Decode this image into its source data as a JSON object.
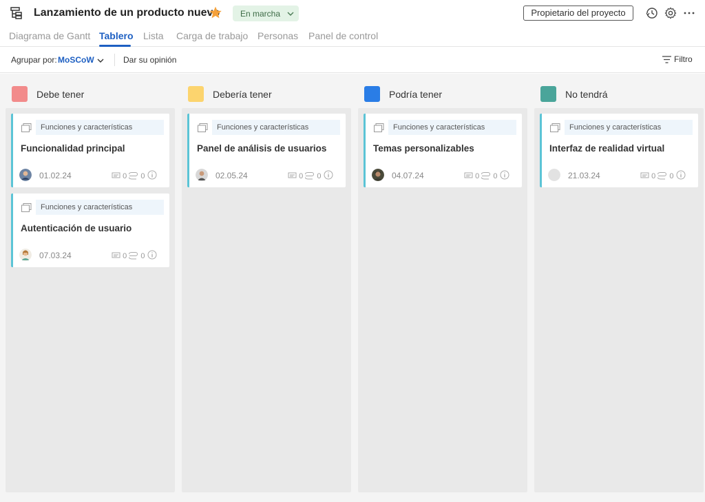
{
  "header": {
    "project_icon": "project-tree-icon",
    "title": "Lanzamiento de un producto nuevo",
    "favorite_icon": "star-icon",
    "status": "En marcha",
    "owner_button": "Propietario del proyecto",
    "icons": [
      "history-icon",
      "gear-icon",
      "more-icon"
    ]
  },
  "tabs": [
    {
      "label": "Diagrama de Gantt"
    },
    {
      "label": "Tablero"
    },
    {
      "label": "Lista"
    },
    {
      "label": "Carga de trabajo"
    },
    {
      "label": "Personas"
    },
    {
      "label": "Panel de control"
    }
  ],
  "toolbar": {
    "group_label": "Agrupar por:",
    "group_value": "MoSCoW",
    "feedback": "Dar su opinión",
    "filter": "Filtro"
  },
  "columns": [
    {
      "title": "Debe tener",
      "color": "#f28b8b"
    },
    {
      "title": "Debería tener",
      "color": "#fcd46e"
    },
    {
      "title": "Podría tener",
      "color": "#2a7de6"
    },
    {
      "title": "No tendrá",
      "color": "#4aa59a"
    }
  ],
  "cards": {
    "c0a": {
      "category": "Funciones y características",
      "title": "Funcionalidad principal",
      "date": "01.02.24",
      "comments": "0",
      "attachments": "0"
    },
    "c0b": {
      "category": "Funciones y características",
      "title": "Autenticación de usuario",
      "date": "07.03.24",
      "comments": "0",
      "attachments": "0"
    },
    "c1a": {
      "category": "Funciones y características",
      "title": "Panel de análisis de usuarios",
      "date": "02.05.24",
      "comments": "0",
      "attachments": "0"
    },
    "c2a": {
      "category": "Funciones y características",
      "title": "Temas personalizables",
      "date": "04.07.24",
      "comments": "0",
      "attachments": "0"
    },
    "c3a": {
      "category": "Funciones y características",
      "title": "Interfaz de realidad virtual",
      "date": "21.03.24",
      "comments": "0",
      "attachments": "0"
    }
  },
  "colors": {
    "accent": "#1d5fc2",
    "card_stripe": "#5bc4d6",
    "status_bg": "#e3f3e6"
  }
}
